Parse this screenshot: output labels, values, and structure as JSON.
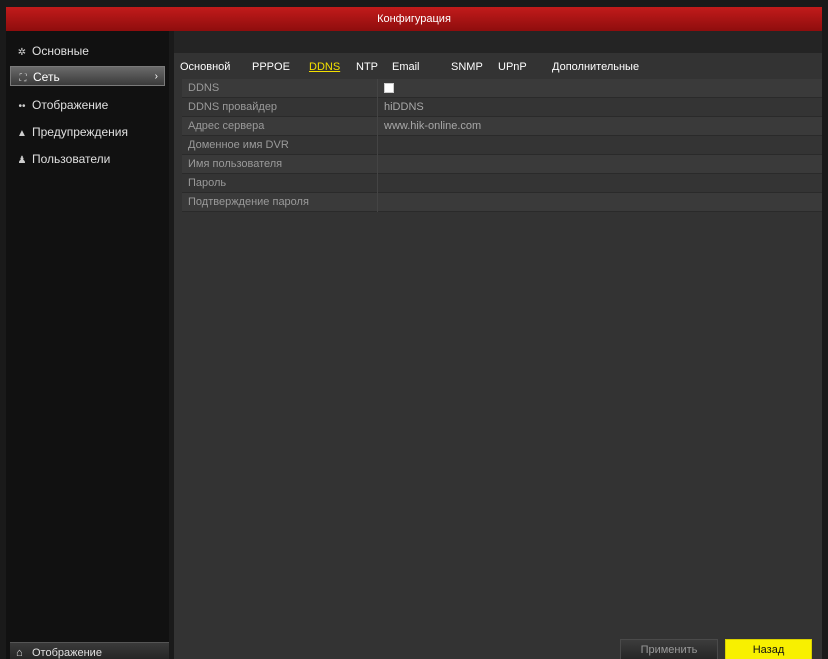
{
  "window": {
    "title": "Конфигурация"
  },
  "sidebar": {
    "items": [
      {
        "label": "Основные",
        "icon": "gear-icon",
        "glyph": "✲"
      },
      {
        "label": "Сеть",
        "icon": "network-icon",
        "glyph": "⛶",
        "active": true
      },
      {
        "label": "Отображение",
        "icon": "display-icon",
        "glyph": "••"
      },
      {
        "label": "Предупреждения",
        "icon": "warning-icon",
        "glyph": "▲"
      },
      {
        "label": "Пользователи",
        "icon": "users-icon",
        "glyph": "♟"
      }
    ],
    "bottom_label": "Отображение",
    "bottom_icon_glyph": "⌂"
  },
  "tabs": [
    {
      "label": "Основной"
    },
    {
      "label": "PPPOE"
    },
    {
      "label": "DDNS",
      "active": true
    },
    {
      "label": "NTP"
    },
    {
      "label": "Email"
    },
    {
      "label": "SNMP"
    },
    {
      "label": "UPnP"
    },
    {
      "label": "Дополнительные"
    }
  ],
  "form": {
    "rows": [
      {
        "label": "DDNS",
        "value": "",
        "type": "checkbox",
        "checked": false
      },
      {
        "label": "DDNS провайдер",
        "value": "hiDDNS"
      },
      {
        "label": "Адрес сервера",
        "value": "www.hik-online.com"
      },
      {
        "label": "Доменное имя DVR",
        "value": ""
      },
      {
        "label": "Имя пользователя",
        "value": ""
      },
      {
        "label": "Пароль",
        "value": ""
      },
      {
        "label": "Подтверждение пароля",
        "value": ""
      }
    ]
  },
  "buttons": {
    "apply": "Применить",
    "back": "Назад"
  },
  "colors": {
    "title_bar": "#b01414",
    "active_tab": "#f3e000",
    "back_button": "#f8f000"
  }
}
